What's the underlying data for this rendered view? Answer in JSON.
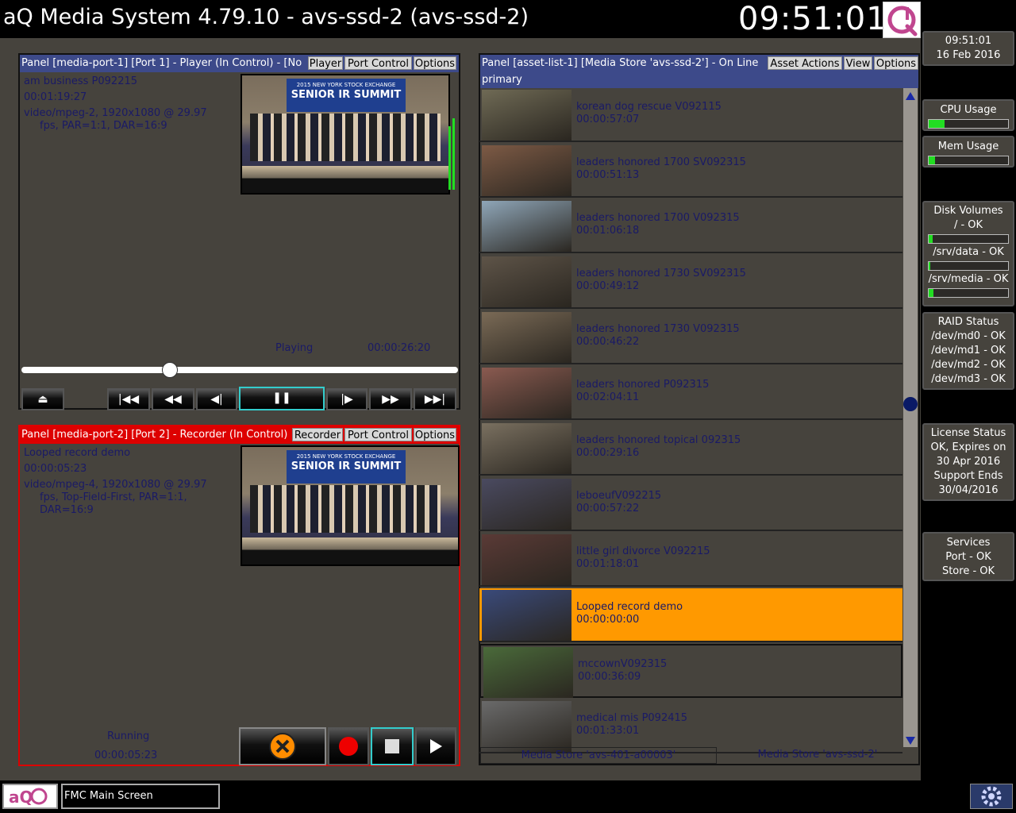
{
  "app": {
    "title": "aQ Media System 4.79.10 - avs-ssd-2 (avs-ssd-2)",
    "clock": "09:51:01"
  },
  "player_panel": {
    "header": "Panel [media-port-1] [Port 1] - Player (In Control) - [No",
    "tabs": [
      "Player",
      "Port Control",
      "Options"
    ],
    "asset_name": "am business P092215",
    "duration": "00:01:19:27",
    "format_line1": "video/mpeg-2, 1920x1080 @ 29.97",
    "format_line2": "fps, PAR=1:1, DAR=16:9",
    "status": "Playing",
    "timecode": "00:00:26:20",
    "position_fraction": 0.34,
    "video_banner": "SENIOR IR SUMMIT",
    "video_banner_top": "2015 NEW YORK STOCK EXCHANGE"
  },
  "recorder_panel": {
    "header": "Panel [media-port-2] [Port 2] - Recorder (In Control)",
    "tabs": [
      "Recorder",
      "Port Control",
      "Options"
    ],
    "asset_name": "Looped record demo",
    "duration": "00:00:05:23",
    "format_line1": "video/mpeg-4, 1920x1080 @ 29.97",
    "format_line2": "fps, Top-Field-First, PAR=1:1,",
    "format_line3": "DAR=16:9",
    "status": "Running",
    "timecode": "00:00:05:23",
    "video_banner": "SENIOR IR SUMMIT",
    "video_banner_top": "2015 NEW YORK STOCK EXCHANGE"
  },
  "asset_panel": {
    "header": "Panel [asset-list-1] [Media Store 'avs-ssd-2'] - On Line",
    "subheader": "primary",
    "tabs": [
      "Asset Actions",
      "View",
      "Options"
    ],
    "assets": [
      {
        "name": "korean dog rescue V092115",
        "duration": "00:00:57:07"
      },
      {
        "name": "leaders honored 1700 SV092315",
        "duration": "00:00:51:13"
      },
      {
        "name": "leaders honored 1700 V092315",
        "duration": "00:01:06:18"
      },
      {
        "name": "leaders honored 1730 SV092315",
        "duration": "00:00:49:12"
      },
      {
        "name": "leaders honored 1730 V092315",
        "duration": "00:00:46:22"
      },
      {
        "name": "leaders honored P092315",
        "duration": "00:02:04:11"
      },
      {
        "name": "leaders honored topical 092315",
        "duration": "00:00:29:16"
      },
      {
        "name": "leboeufV092215",
        "duration": "00:00:57:22"
      },
      {
        "name": "little girl divorce V092215",
        "duration": "00:01:18:01"
      },
      {
        "name": "Looped record demo",
        "duration": "00:00:00:00"
      },
      {
        "name": "mccownV092315",
        "duration": "00:00:36:09"
      },
      {
        "name": "medical mis P092415",
        "duration": "00:01:33:01"
      }
    ],
    "selected_index": 9,
    "store_tabs": [
      "Media Store 'avs-401-a00003'",
      "Media Store 'avs-ssd-2'"
    ]
  },
  "sidebar": {
    "time": "09:51:01",
    "date": "16 Feb 2016",
    "cpu_label": "CPU Usage",
    "cpu_fraction": 0.2,
    "mem_label": "Mem Usage",
    "mem_fraction": 0.08,
    "disk_title": "Disk Volumes",
    "disks": [
      {
        "label": "/ - OK",
        "fraction": 0.05
      },
      {
        "label": "/srv/data - OK",
        "fraction": 0.02
      },
      {
        "label": "/srv/media - OK",
        "fraction": 0.06
      }
    ],
    "raid_title": "RAID Status",
    "raid": [
      "/dev/md0 - OK",
      "/dev/md1 - OK",
      "/dev/md2 - OK",
      "/dev/md3 - OK"
    ],
    "license_lines": [
      "License Status",
      "OK, Expires on",
      "30 Apr 2016",
      "Support Ends",
      "30/04/2016"
    ],
    "services_lines": [
      "Services",
      "Port - OK",
      "Store - OK"
    ]
  },
  "bottom": {
    "logo": "aQ",
    "screen_name": "FMC Main Screen"
  },
  "colors": {
    "panel_bg": "#46433d",
    "player_header": "#3d4a8a",
    "recorder_header": "#dd0000",
    "selected_row": "#ff9900",
    "accent_cyan": "#33cccc"
  }
}
